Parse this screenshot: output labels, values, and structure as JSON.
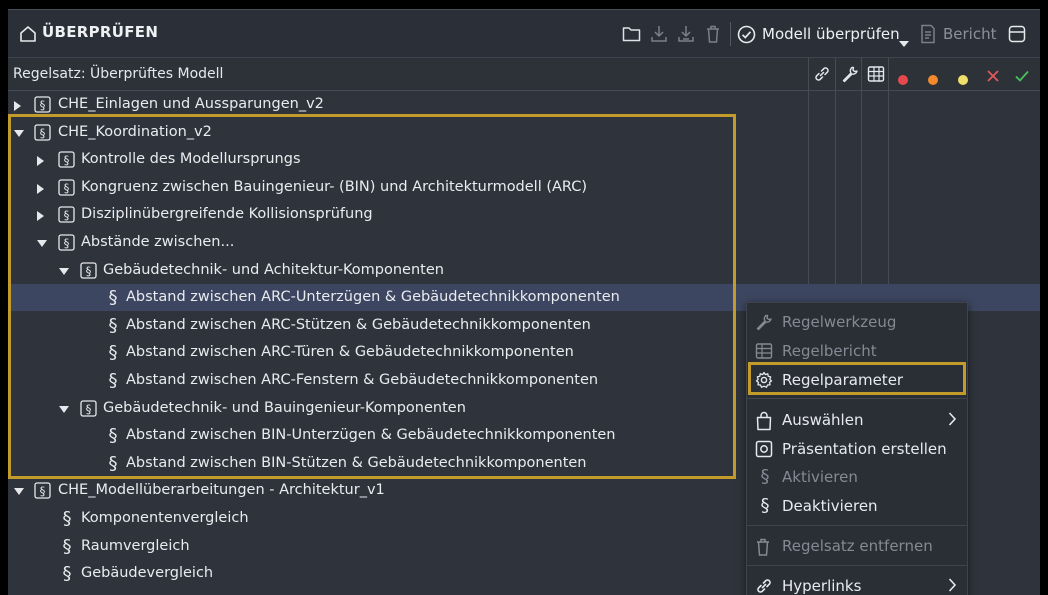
{
  "window": {
    "title": "ÜBERPRÜFEN"
  },
  "toolbar": {
    "check_label": "Modell überprüfen",
    "report_label": "Bericht"
  },
  "table": {
    "header_label": "Regelsatz: Überprüftes Modell"
  },
  "colors": {
    "accent": "#c29b2a",
    "selected_row": "#3d4660",
    "status_red": "#e5484d",
    "status_orange": "#f2892d",
    "status_yellow": "#f0e06a",
    "status_cross": "#e05a5a",
    "status_check": "#4cc15a"
  },
  "tree": [
    {
      "label": "CHE_Einlagen und Aussparungen_v2",
      "level": 0,
      "expander": "collapsed",
      "icon": "ruleset-icon"
    },
    {
      "label": "CHE_Koordination_v2",
      "level": 0,
      "expander": "expanded",
      "icon": "ruleset-icon"
    },
    {
      "label": "Kontrolle des Modellursprungs",
      "level": 1,
      "expander": "collapsed",
      "icon": "ruleset-icon"
    },
    {
      "label": "Kongruenz zwischen Bauingenieur- (BIN) und Architekturmodell (ARC)",
      "level": 1,
      "expander": "collapsed",
      "icon": "ruleset-icon"
    },
    {
      "label": "Disziplinübergreifende Kollisionsprüfung",
      "level": 1,
      "expander": "collapsed",
      "icon": "ruleset-icon"
    },
    {
      "label": "Abstände zwischen...",
      "level": 1,
      "expander": "expanded",
      "icon": "ruleset-icon"
    },
    {
      "label": "Gebäudetechnik- und Achitektur-Komponenten",
      "level": 2,
      "expander": "expanded",
      "icon": "ruleset-icon"
    },
    {
      "label": "Abstand zwischen ARC-Unterzügen & Gebäudetechnikkomponenten",
      "level": 3,
      "expander": "none",
      "icon": "rule-icon",
      "selected": true
    },
    {
      "label": "Abstand zwischen ARC-Stützen & Gebäudetechnikkomponenten",
      "level": 3,
      "expander": "none",
      "icon": "rule-icon"
    },
    {
      "label": "Abstand zwischen ARC-Türen & Gebäudetechnikkomponenten",
      "level": 3,
      "expander": "none",
      "icon": "rule-icon"
    },
    {
      "label": "Abstand zwischen ARC-Fenstern & Gebäudetechnikkomponenten",
      "level": 3,
      "expander": "none",
      "icon": "rule-icon"
    },
    {
      "label": "Gebäudetechnik- und Bauingenieur-Komponenten",
      "level": 2,
      "expander": "expanded",
      "icon": "ruleset-icon"
    },
    {
      "label": "Abstand zwischen BIN-Unterzügen & Gebäudetechnikkomponenten",
      "level": 3,
      "expander": "none",
      "icon": "rule-icon"
    },
    {
      "label": "Abstand zwischen BIN-Stützen & Gebäudetechnikkomponenten",
      "level": 3,
      "expander": "none",
      "icon": "rule-icon"
    },
    {
      "label": "CHE_Modellüberarbeitungen - Architektur_v1",
      "level": 0,
      "expander": "expanded",
      "icon": "ruleset-icon"
    },
    {
      "label": "Komponentenvergleich",
      "level": 1,
      "expander": "none",
      "icon": "rule-icon"
    },
    {
      "label": "Raumvergleich",
      "level": 1,
      "expander": "none",
      "icon": "rule-icon"
    },
    {
      "label": "Gebäudevergleich",
      "level": 1,
      "expander": "none",
      "icon": "rule-icon"
    }
  ],
  "context_menu": {
    "items": [
      {
        "label": "Regelwerkzeug",
        "icon": "wrench-icon",
        "disabled": true
      },
      {
        "label": "Regelbericht",
        "icon": "table-icon",
        "disabled": true
      },
      {
        "label": "Regelparameter",
        "icon": "gear-icon",
        "disabled": false,
        "highlighted": true
      },
      {
        "label": "Auswählen",
        "icon": "bag-icon",
        "disabled": false,
        "submenu": true
      },
      {
        "label": "Präsentation erstellen",
        "icon": "presentation-icon",
        "disabled": false
      },
      {
        "label": "Aktivieren",
        "icon": "paragraph-icon",
        "disabled": true
      },
      {
        "label": "Deaktivieren",
        "icon": "paragraph-icon",
        "disabled": false
      },
      {
        "label": "Regelsatz entfernen",
        "icon": "trash-icon",
        "disabled": true
      },
      {
        "label": "Hyperlinks",
        "icon": "link-icon",
        "disabled": false,
        "submenu": true
      }
    ]
  }
}
